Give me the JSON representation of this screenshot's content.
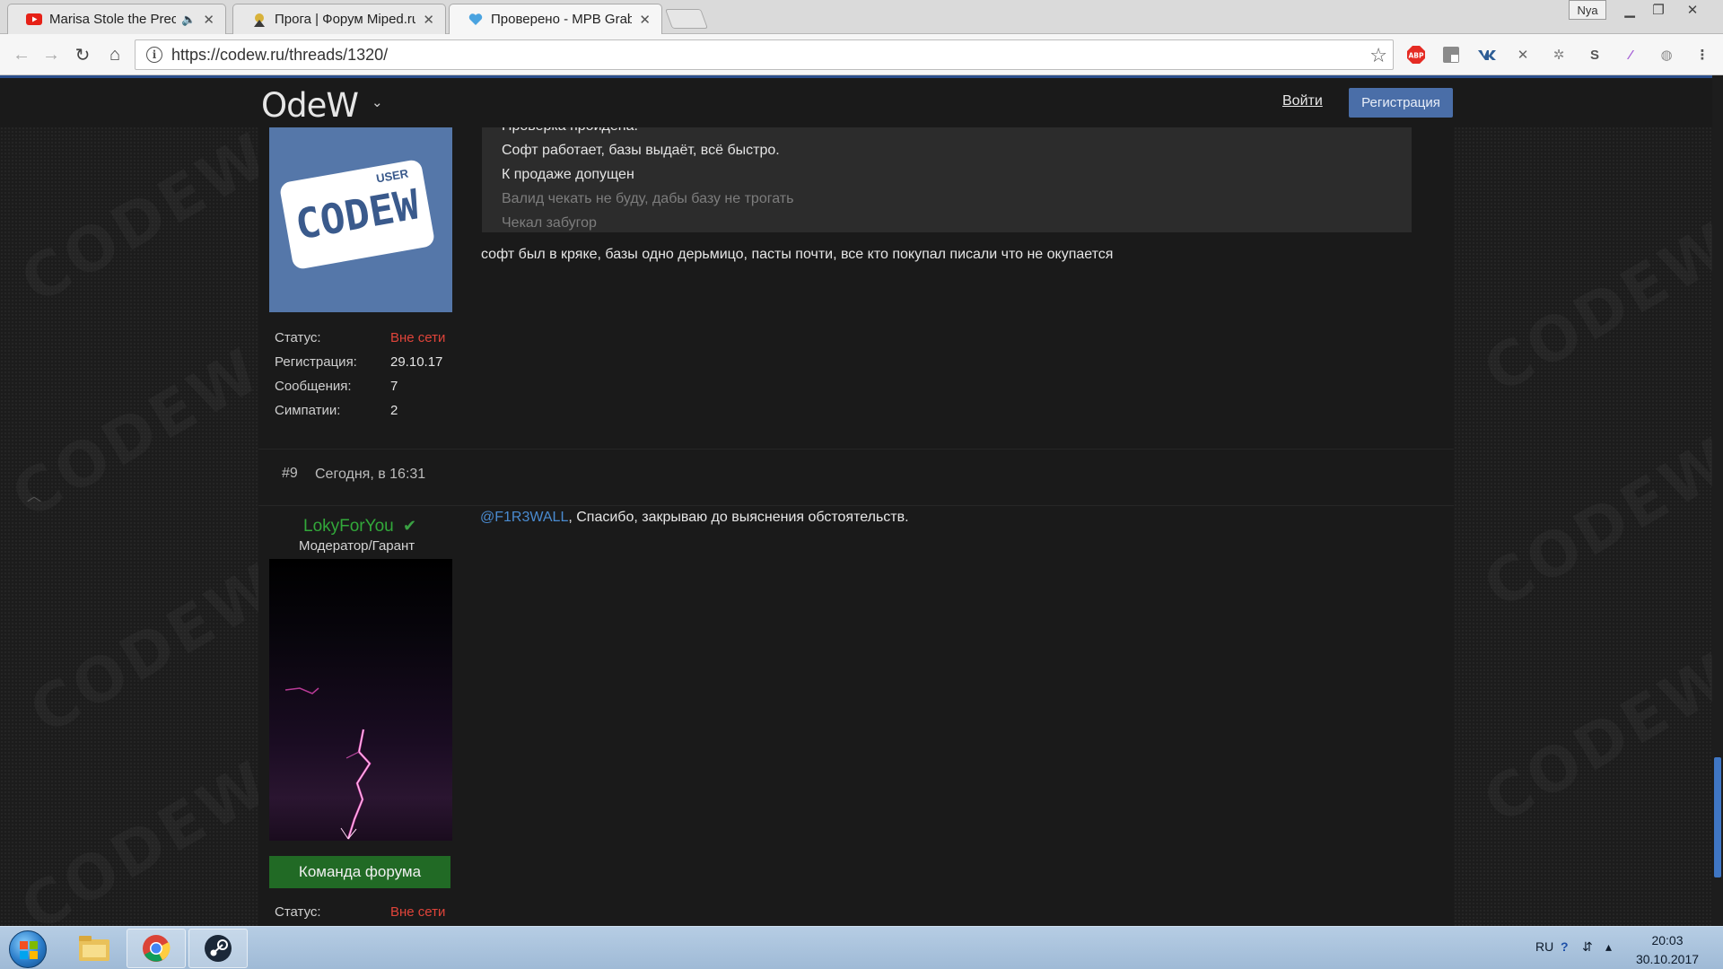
{
  "browser": {
    "tabs": [
      {
        "title": "Marisa Stole the Preci",
        "favicon": "youtube-icon",
        "muted": true
      },
      {
        "title": "Прога | Форум Miped.ru",
        "favicon": "miped-icon",
        "muted": false
      },
      {
        "title": "Проверено - MPB Grabe",
        "favicon": "codew-heart-icon",
        "muted": false
      }
    ],
    "active_tab": 2,
    "profile": "Nya",
    "url": "https://codew.ru/threads/1320/",
    "extensions": [
      "abp-icon",
      "translate-icon",
      "vk-icon",
      "x-icon",
      "gear-icon",
      "s-icon",
      "pen-icon",
      "globe-icon"
    ],
    "ext_abp_label": "ABP",
    "ext_s_label": "S"
  },
  "site": {
    "logo": "ОdеW",
    "nav": {
      "login": "Войти",
      "register": "Регистрация"
    },
    "accent": "#4a6ea8"
  },
  "post1": {
    "avatar_text": "CODEW",
    "avatar_badge": "USER",
    "quote_lines": [
      {
        "text": "Проверка пройдена.",
        "dim": false
      },
      {
        "text": "Софт работает, базы выдаёт, всё быстро.",
        "dim": false
      },
      {
        "text": "К продаже допущен",
        "dim": false
      },
      {
        "text": "Валид чекать не буду, дабы базу не трогать",
        "dim": true
      },
      {
        "text": "Чекал забугор",
        "dim": true
      }
    ],
    "message": "софт был в кряке, базы одно дерьмицо, пасты почти, все кто покупал писали что не окупается",
    "stats": [
      {
        "key": "Статус:",
        "value": "Вне сети",
        "status": true
      },
      {
        "key": "Регистрация:",
        "value": "29.10.17",
        "status": false
      },
      {
        "key": "Сообщения:",
        "value": "7",
        "status": false
      },
      {
        "key": "Симпатии:",
        "value": "2",
        "status": false
      }
    ]
  },
  "post2": {
    "number": "#9",
    "date": "Сегодня, в 16:31",
    "username": "LokyForYou",
    "role": "Модератор/Гарант",
    "team_button": "Команда форума",
    "mention": "@F1R3WALL",
    "message": ", Спасибо, закрываю до выяснения обстоятельств.",
    "status_key": "Статус:",
    "status_value": "Вне сети"
  },
  "taskbar": {
    "apps": [
      "explorer-icon",
      "chrome-icon",
      "steam-icon"
    ],
    "lang": "RU",
    "time": "20:03",
    "date": "30.10.2017"
  },
  "watermark": "CODEW"
}
